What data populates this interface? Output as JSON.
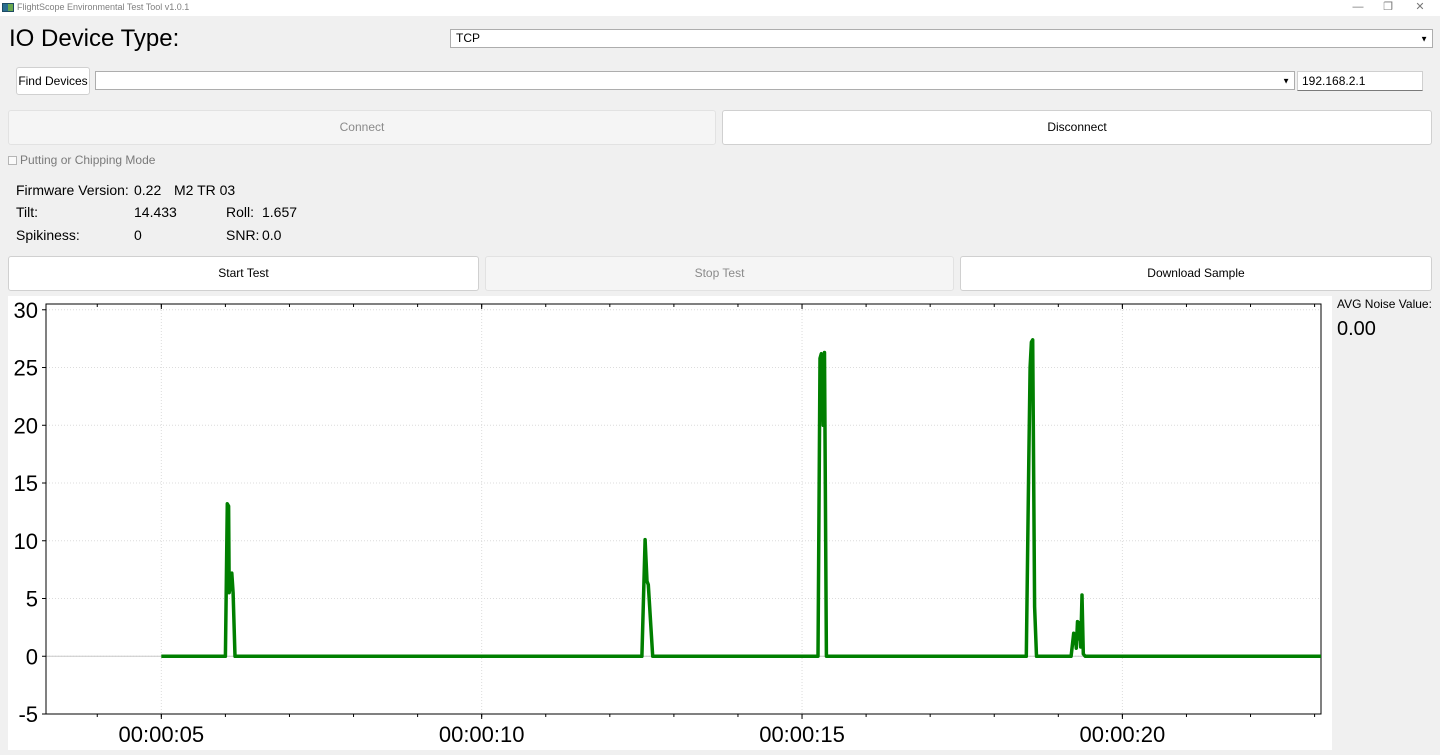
{
  "window": {
    "title": "FlightScope Environmental Test Tool v1.0.1",
    "minimize_glyph": "—",
    "restore_glyph": "❐",
    "close_glyph": "✕"
  },
  "io": {
    "label": "IO Device Type:",
    "selected": "TCP"
  },
  "devices": {
    "find_label": "Find Devices",
    "selected": "",
    "ip_value": "192.168.2.1"
  },
  "connection": {
    "connect_label": "Connect",
    "disconnect_label": "Disconnect"
  },
  "mode": {
    "label": "Putting or Chipping Mode"
  },
  "info": {
    "firmware_label": "Firmware Version:",
    "firmware_value": "0.22",
    "device_name": "M2 TR 03",
    "tilt_label": "Tilt:",
    "tilt_value": "14.433",
    "roll_label": "Roll:",
    "roll_value": "1.657",
    "spikiness_label": "Spikiness:",
    "spikiness_value": "0",
    "snr_label": "SNR:",
    "snr_value": "0.0"
  },
  "test": {
    "start_label": "Start Test",
    "stop_label": "Stop Test",
    "download_label": "Download Sample"
  },
  "noise": {
    "label": "AVG Noise Value:",
    "value": "0.00"
  },
  "colors": {
    "series": "#007f00",
    "grid": "#dcdcdc"
  },
  "chart_data": {
    "type": "line",
    "title": "",
    "xlabel": "",
    "ylabel": "",
    "xlim": [
      3.2,
      23.1
    ],
    "ylim": [
      -5,
      30.5
    ],
    "yticks": [
      -5,
      0,
      5,
      10,
      15,
      20,
      25,
      30
    ],
    "xticks": [
      5,
      10,
      15,
      20
    ],
    "xtick_labels": [
      "00:00:05",
      "00:00:10",
      "00:00:15",
      "00:00:20"
    ],
    "grid": true,
    "series": [
      {
        "x": [
          5.0,
          6.0,
          6.03,
          6.05,
          6.06,
          6.1,
          6.12,
          6.15,
          7.0,
          12.5,
          12.55,
          12.58,
          12.6,
          12.67,
          12.7,
          14.0,
          15.25,
          15.28,
          15.3,
          15.33,
          15.35,
          15.38,
          15.41,
          16.5,
          18.5,
          18.54,
          18.56,
          18.58,
          18.6,
          18.63,
          18.66,
          18.7,
          19.2,
          19.24,
          19.26,
          19.28,
          19.3,
          19.31,
          19.33,
          19.35,
          19.37,
          19.39,
          19.42,
          19.45,
          20.5,
          23.1
        ],
        "values": [
          0,
          0,
          13.2,
          13,
          5.5,
          7.2,
          5.5,
          0,
          0,
          0,
          10.1,
          6.5,
          6.2,
          0,
          0,
          0,
          0,
          25.8,
          26.2,
          20,
          26.3,
          0,
          0,
          0,
          0,
          17,
          25,
          27.2,
          27.4,
          4.3,
          0,
          0,
          0,
          2,
          1.9,
          0.7,
          3,
          1.5,
          2.9,
          0.8,
          5.3,
          0.2,
          0,
          0,
          0,
          0
        ]
      }
    ]
  }
}
